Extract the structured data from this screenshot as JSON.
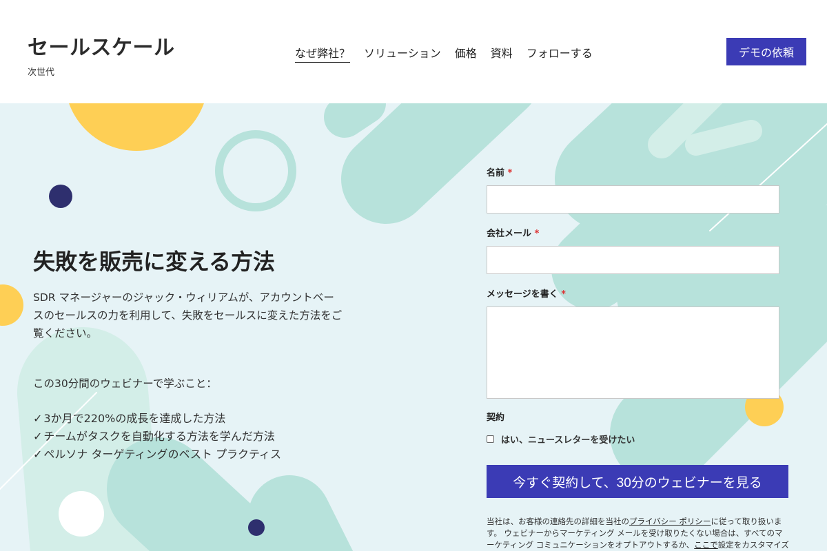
{
  "header": {
    "brand_title": "セールスケール",
    "brand_subtitle": "次世代",
    "nav": [
      {
        "label": "なぜ弊社？",
        "active": true
      },
      {
        "label": "ソリューション",
        "active": false
      },
      {
        "label": "価格",
        "active": false
      },
      {
        "label": "資料",
        "active": false
      },
      {
        "label": "フォローする",
        "active": false
      }
    ],
    "demo_button": "デモの依頼"
  },
  "hero": {
    "headline": "失敗を販売に変える方法",
    "intro": "SDR マネージャーのジャック・ウィリアムが、アカウントベースのセールスの力を利用して、失敗をセールスに変えた方法をご覧ください。",
    "learn_intro": "この30分間のウェビナーで学ぶこと：",
    "check_mark": "✓",
    "learn_points": [
      "3か月で220%の成長を達成した方法",
      "チームがタスクを自動化する方法を学んだ方法",
      "ペルソナ ターゲティングのベスト プラクティス"
    ]
  },
  "form": {
    "name_label": "名前",
    "email_label": "会社メール",
    "message_label": "メッセージを書く",
    "required_mark": "*",
    "name_value": "",
    "email_value": "",
    "message_value": "",
    "contract_label": "契約",
    "newsletter_label": "はい、ニュースレターを受けたい",
    "submit_label": "今すぐ契約して、30分のウェビナーを見る",
    "disclaimer_part1": "当社は、お客様の連絡先の詳細を当社の",
    "privacy_link": "プライバシー ポリシー",
    "disclaimer_part2": "に従って取り扱います。 ウェビナーからマーケティング メールを受け取りたくない場合は、すべてのマーケティング コミュニケーションをオプトアウトするか、",
    "here_link": "ここで",
    "disclaimer_part3": "設定をカスタマイズできます。"
  },
  "colors": {
    "accent": "#3b3bb5",
    "mint": "#b7e2db",
    "mint_light": "#d3eee8",
    "yellow": "#fecf55",
    "navy": "#2e2f6e",
    "hero_bg": "#e6f3f6"
  }
}
